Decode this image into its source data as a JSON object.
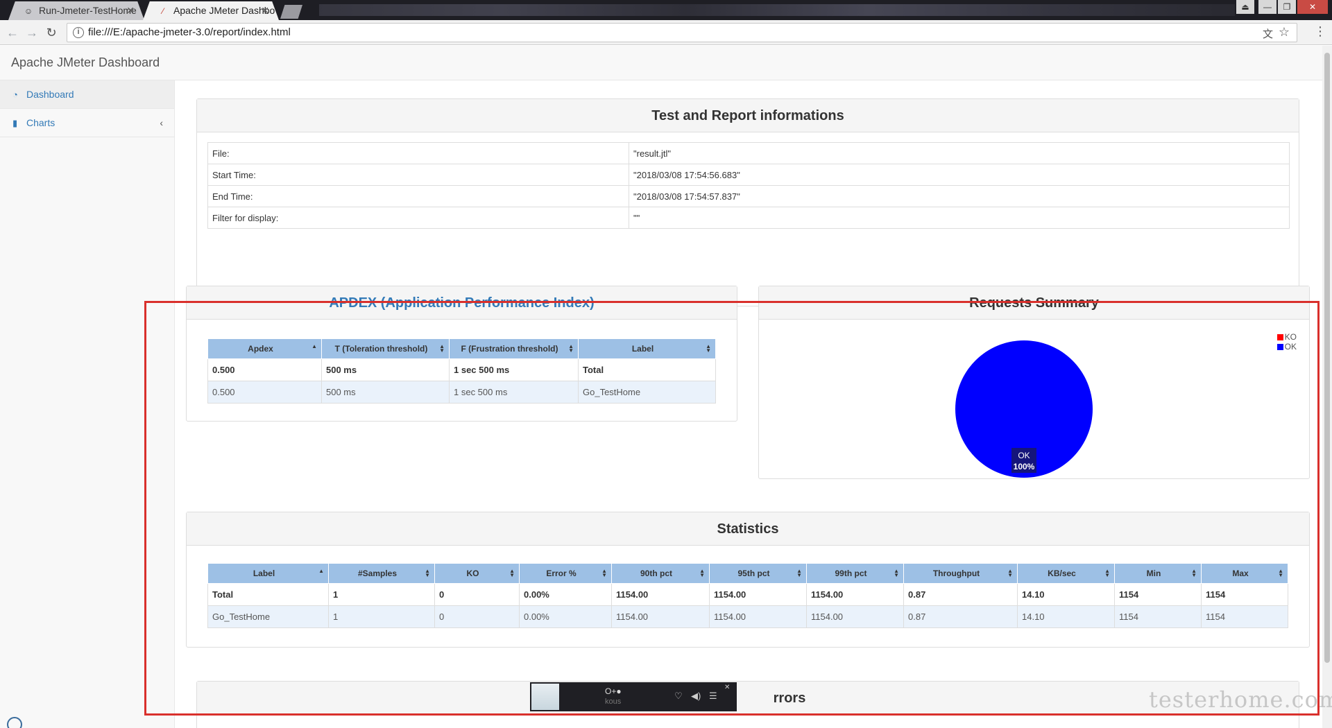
{
  "browser": {
    "tabs": [
      {
        "title": "Run-Jmeter-TestHome",
        "active": false
      },
      {
        "title": "Apache JMeter Dashbo",
        "active": true
      }
    ],
    "url": "file:///E:/apache-jmeter-3.0/report/index.html"
  },
  "app": {
    "brand": "Apache JMeter Dashboard",
    "sidebar": [
      {
        "label": "Dashboard",
        "icon": "dashboard-icon"
      },
      {
        "label": "Charts",
        "icon": "bar-chart-icon"
      }
    ]
  },
  "test_info": {
    "title": "Test and Report informations",
    "rows": [
      {
        "key": "File:",
        "value": "\"result.jtl\""
      },
      {
        "key": "Start Time:",
        "value": "\"2018/03/08 17:54:56.683\""
      },
      {
        "key": "End Time:",
        "value": "\"2018/03/08 17:54:57.837\""
      },
      {
        "key": "Filter for display:",
        "value": "\"\""
      }
    ]
  },
  "apdex": {
    "title": "APDEX (Application Performance Index)",
    "headers": [
      "Apdex",
      "T (Toleration threshold)",
      "F (Frustration threshold)",
      "Label"
    ],
    "rows": [
      [
        "0.500",
        "500 ms",
        "1 sec 500 ms",
        "Total"
      ],
      [
        "0.500",
        "500 ms",
        "1 sec 500 ms",
        "Go_TestHome"
      ]
    ]
  },
  "requests_summary": {
    "title": "Requests Summary",
    "legend": [
      {
        "label": "KO",
        "color": "#ff0000"
      },
      {
        "label": "OK",
        "color": "#0000ff"
      }
    ],
    "slice_label": "OK",
    "slice_pct": "100%"
  },
  "chart_data": {
    "type": "pie",
    "title": "Requests Summary",
    "categories": [
      "KO",
      "OK"
    ],
    "values": [
      0,
      100
    ],
    "colors": [
      "#ff0000",
      "#0000ff"
    ],
    "legend": "top-right"
  },
  "statistics": {
    "title": "Statistics",
    "headers": [
      "Label",
      "#Samples",
      "KO",
      "Error %",
      "90th pct",
      "95th pct",
      "99th pct",
      "Throughput",
      "KB/sec",
      "Min",
      "Max"
    ],
    "rows": [
      [
        "Total",
        "1",
        "0",
        "0.00%",
        "1154.00",
        "1154.00",
        "1154.00",
        "0.87",
        "14.10",
        "1154",
        "1154"
      ],
      [
        "Go_TestHome",
        "1",
        "0",
        "0.00%",
        "1154.00",
        "1154.00",
        "1154.00",
        "0.87",
        "14.10",
        "1154",
        "1154"
      ]
    ]
  },
  "errors": {
    "title_visible": "rrors"
  },
  "player": {
    "title": "O+●",
    "subtitle": "kous"
  },
  "watermark": "testerhome.com"
}
